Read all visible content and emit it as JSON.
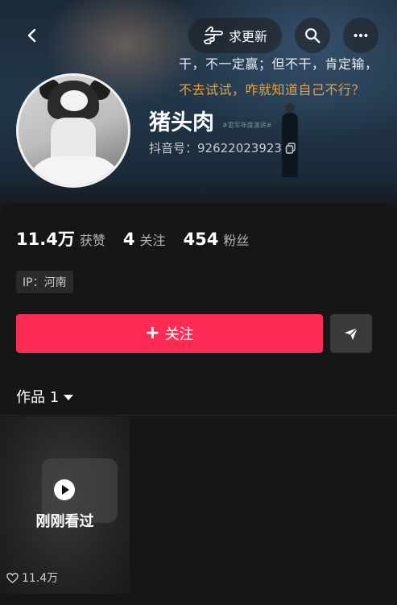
{
  "banner": {
    "slogan_line1": "干，不一定赢；但不干，肯定输，",
    "slogan_line2": "不去试试，咋就知道自己不行？",
    "event_text": "#雷军年度演讲#"
  },
  "nav": {
    "update_label": "求更新"
  },
  "profile": {
    "name": "猪头肉",
    "douyin_id": "抖音号：92622023923"
  },
  "stats": [
    {
      "value": "11.4万",
      "label": "获赞"
    },
    {
      "value": "4",
      "label": "关注"
    },
    {
      "value": "454",
      "label": "粉丝"
    }
  ],
  "ip_tag": "IP：河南",
  "actions": {
    "follow_label": "关注",
    "follow_plus": "+"
  },
  "tabs": {
    "works_label": "作品 1"
  },
  "videos": [
    {
      "status": "刚刚看过",
      "likes": "11.4万"
    }
  ],
  "colors": {
    "accent": "#fe2c55",
    "background": "#161616",
    "slogan_highlight": "#e7a23a"
  }
}
